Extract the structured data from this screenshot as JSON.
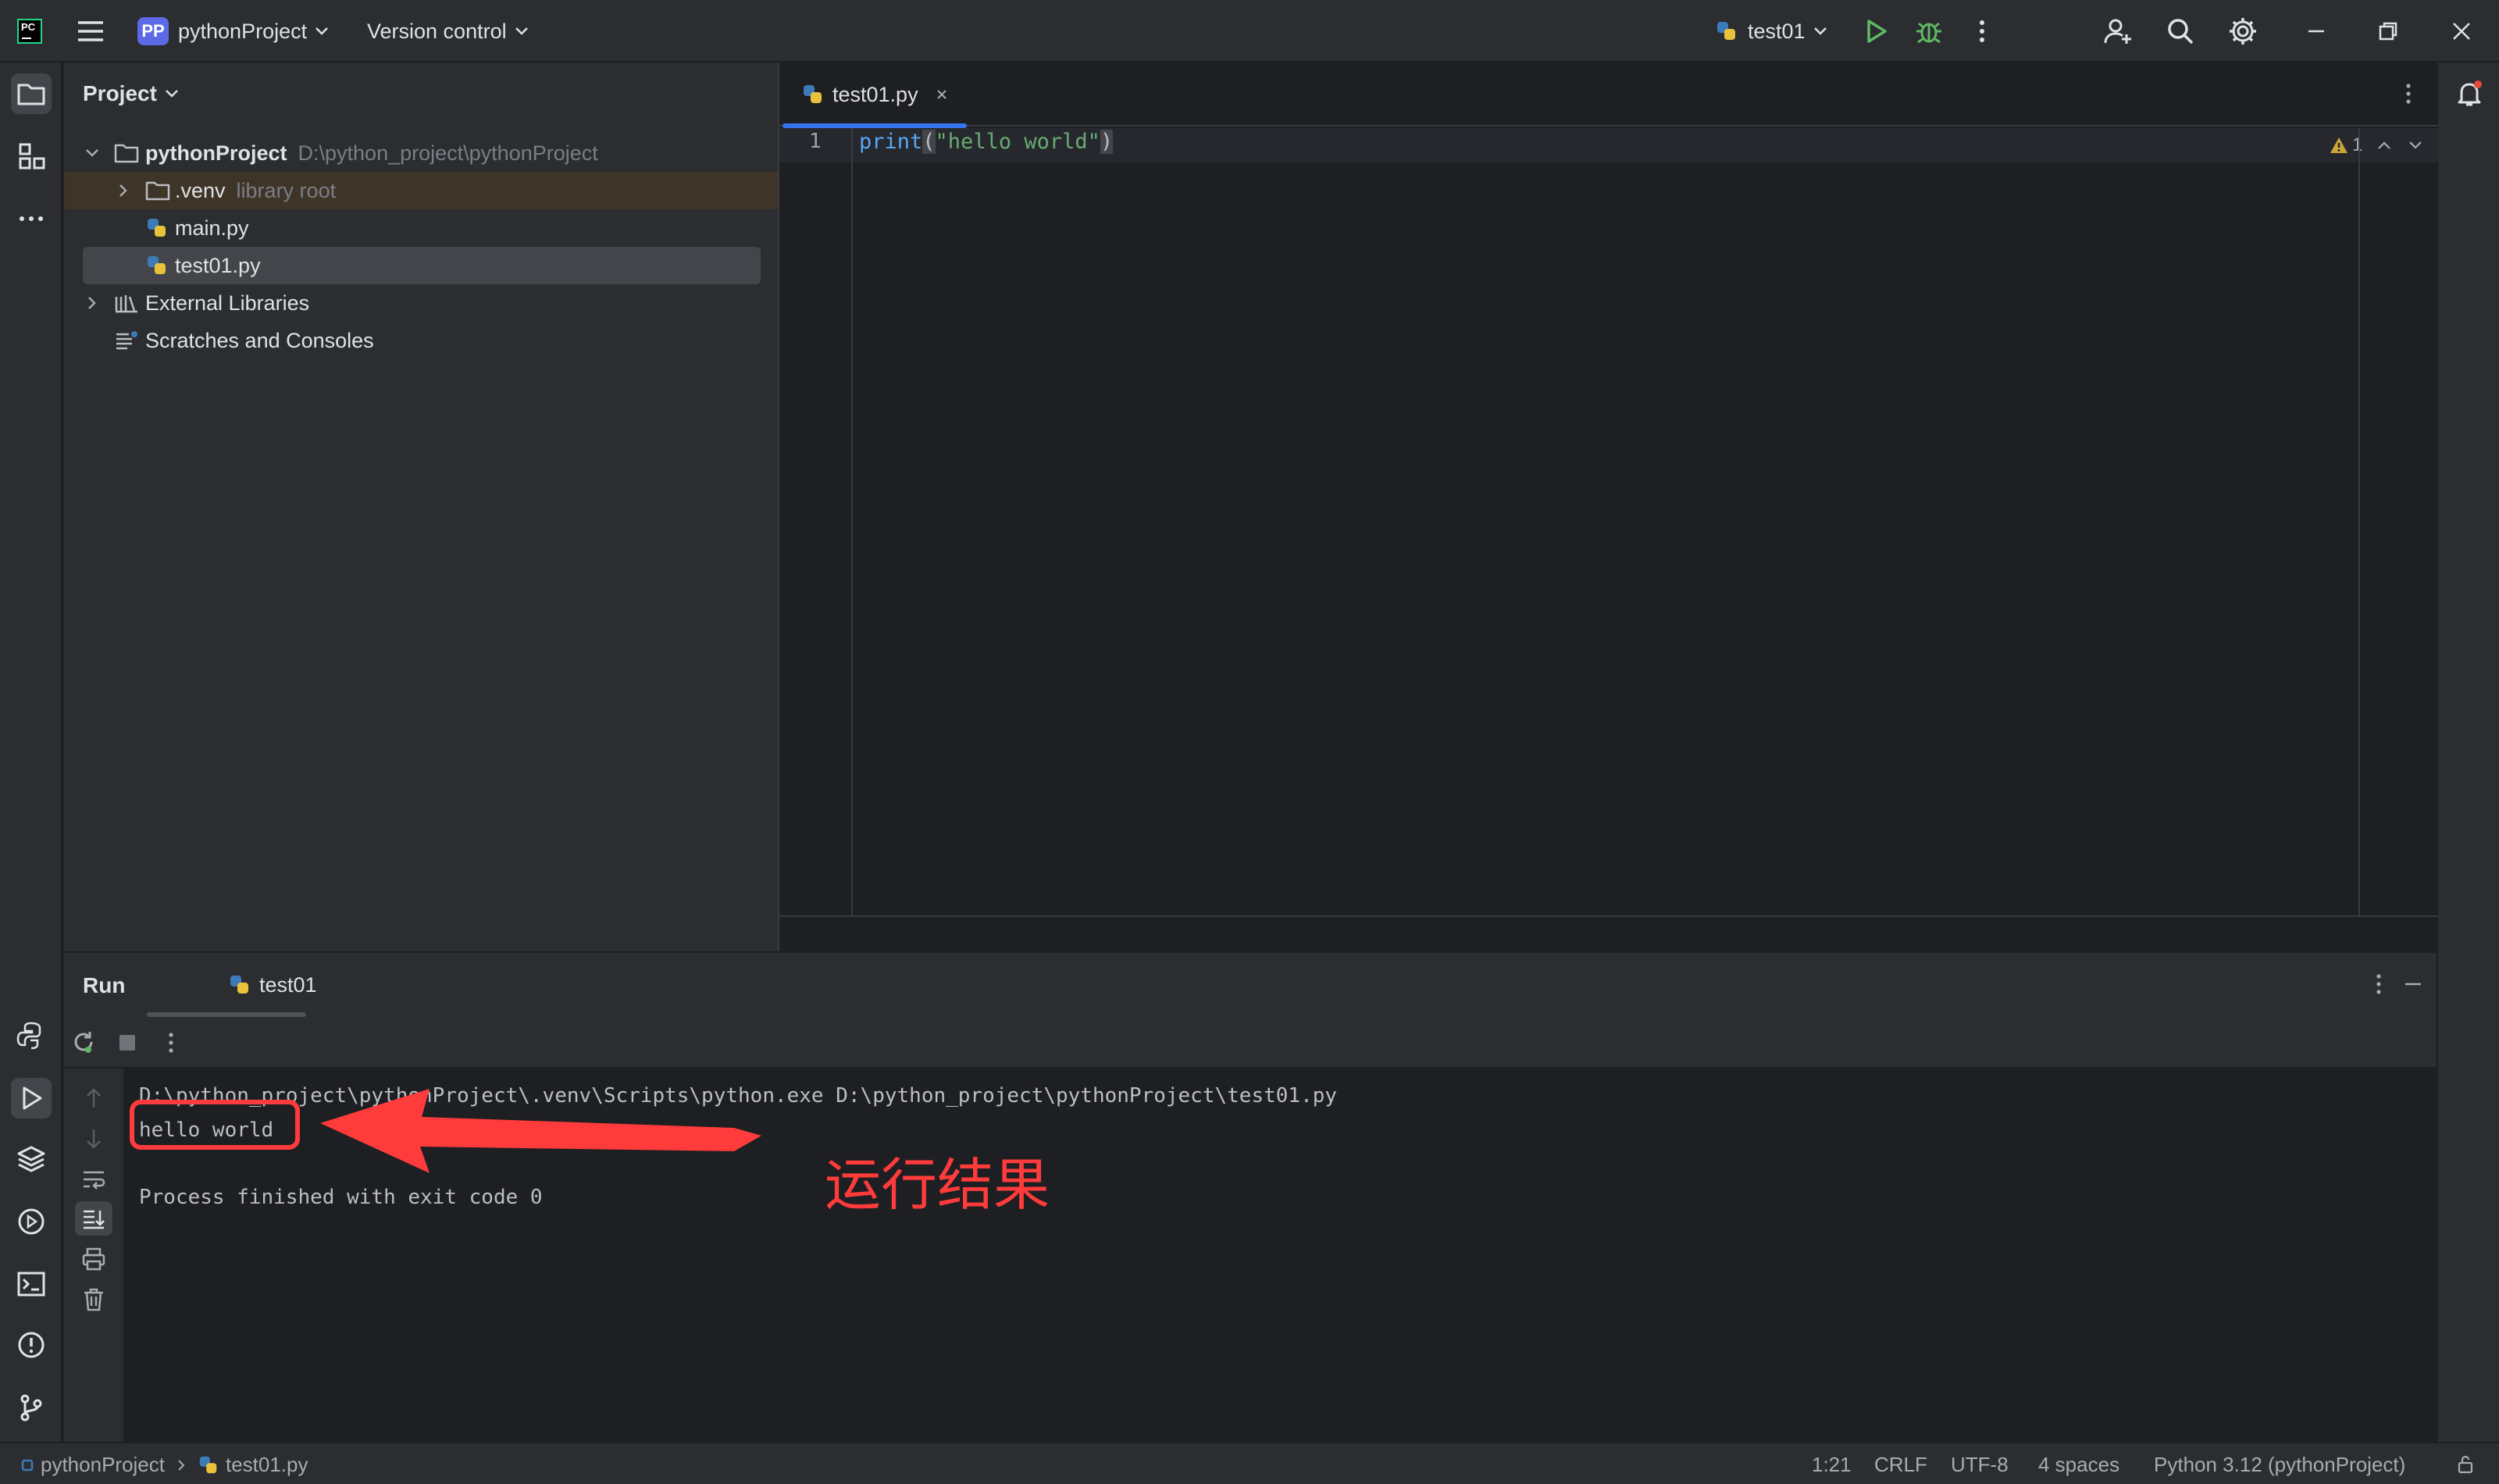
{
  "titlebar": {
    "project_badge": "PP",
    "project_name": "pythonProject",
    "version_control": "Version control",
    "run_config": "test01"
  },
  "project_panel": {
    "title": "Project",
    "root_name": "pythonProject",
    "root_path": "D:\\python_project\\pythonProject",
    "venv_name": ".venv",
    "venv_hint": "library root",
    "files": [
      "main.py",
      "test01.py"
    ],
    "external_libraries": "External Libraries",
    "scratches": "Scratches and Consoles"
  },
  "editor": {
    "tab_label": "test01.py",
    "line_number": "1",
    "code_fn": "print",
    "code_open": "(",
    "code_str": "\"hello world\"",
    "code_close": ")",
    "warning_count": "1"
  },
  "run_panel": {
    "title": "Run",
    "tab_label": "test01",
    "console": {
      "command": "D:\\python_project\\pythonProject\\.venv\\Scripts\\python.exe D:\\python_project\\pythonProject\\test01.py",
      "output": "hello world",
      "exit": "Process finished with exit code 0"
    },
    "annotation": "运行结果"
  },
  "statusbar": {
    "breadcrumb_project": "pythonProject",
    "breadcrumb_file": "test01.py",
    "position": "1:21",
    "line_sep": "CRLF",
    "encoding": "UTF-8",
    "indent": "4 spaces",
    "interpreter": "Python 3.12 (pythonProject)"
  },
  "colors": {
    "accent": "#3574f0",
    "annotation": "#ff3b3b",
    "run_green": "#5fb865",
    "selection": "#43454a"
  }
}
